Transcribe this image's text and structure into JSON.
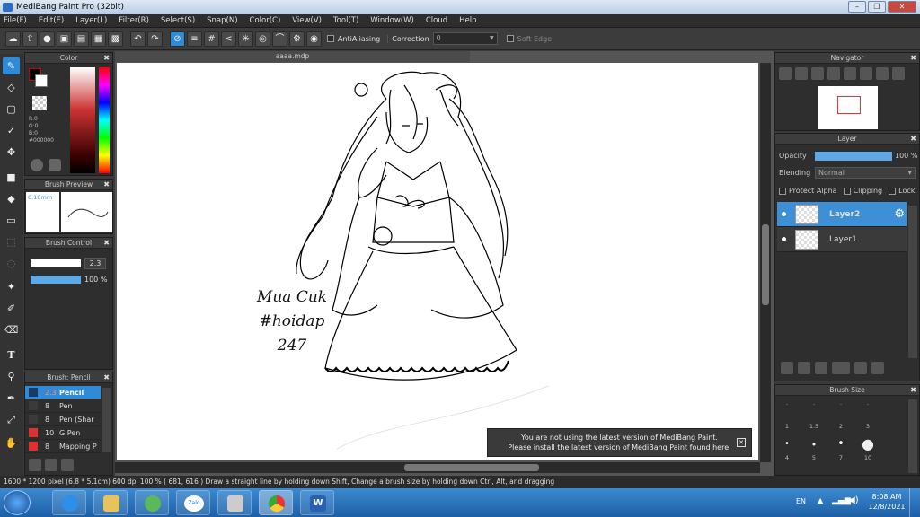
{
  "window": {
    "title": "MediBang Paint Pro (32bit)"
  },
  "menu": [
    "File(F)",
    "Edit(E)",
    "Layer(L)",
    "Filter(R)",
    "Select(S)",
    "Snap(N)",
    "Color(C)",
    "View(V)",
    "Tool(T)",
    "Window(W)",
    "Cloud",
    "Help"
  ],
  "toolbar": {
    "antialias_label": "AntiAliasing",
    "correction_label": "Correction",
    "correction_value": "0",
    "softedge_label": "Soft Edge"
  },
  "document": {
    "tab": "aaaa.mdp",
    "handwriting": [
      "Mua Cuk",
      "#hoidap",
      "247"
    ]
  },
  "color_panel": {
    "title": "Color",
    "values": [
      "R:0",
      "G:0",
      "B:0",
      "#000000"
    ],
    "primary": "#000000"
  },
  "brush_preview": {
    "title": "Brush Preview",
    "size": "0.10mm"
  },
  "brush_control": {
    "title": "Brush Control",
    "size": "2.3",
    "opacity": "100 %",
    "opacity_level": 1.0
  },
  "brush_panel": {
    "title": "Brush: Pencil",
    "items": [
      {
        "size": "2.3",
        "name": "Pencil",
        "color": "#1a3a6a",
        "selected": true
      },
      {
        "size": "8",
        "name": "Pen",
        "color": "#3a3a3a",
        "selected": false
      },
      {
        "size": "8",
        "name": "Pen (Shar",
        "color": "#3a3a3a",
        "selected": false
      },
      {
        "size": "10",
        "name": "G Pen",
        "color": "#e03030",
        "selected": false
      },
      {
        "size": "8",
        "name": "Mapping P",
        "color": "#e03030",
        "selected": false
      }
    ]
  },
  "navigator": {
    "title": "Navigator"
  },
  "layer_panel": {
    "title": "Layer",
    "opacity_label": "Opacity",
    "opacity_value": "100 %",
    "opacity_level": 1.0,
    "blending_label": "Blending",
    "blending_value": "Normal",
    "protect_alpha": "Protect Alpha",
    "clipping": "Clipping",
    "lock": "Lock",
    "layers": [
      "Layer2",
      "Layer1"
    ]
  },
  "brush_size_panel": {
    "title": "Brush Size",
    "sizes": [
      "1",
      "1.5",
      "2",
      "3",
      "4",
      "5",
      "7",
      "10"
    ]
  },
  "notice": {
    "line1": "You are not using the latest version of MediBang Paint.",
    "line2": "Please install the latest version of MediBang Paint found here."
  },
  "status": {
    "text": "1600 * 1200 pixel   (6.8 * 5.1cm)   600 dpi   100 %   ( 681, 616 )   Draw a straight line by holding down Shift, Change a brush size by holding down Ctrl, Alt, and dragging"
  },
  "taskbar": {
    "lang": "EN",
    "time": "8:08 AM",
    "date": "12/8/2021",
    "zalo": "Zalo"
  }
}
